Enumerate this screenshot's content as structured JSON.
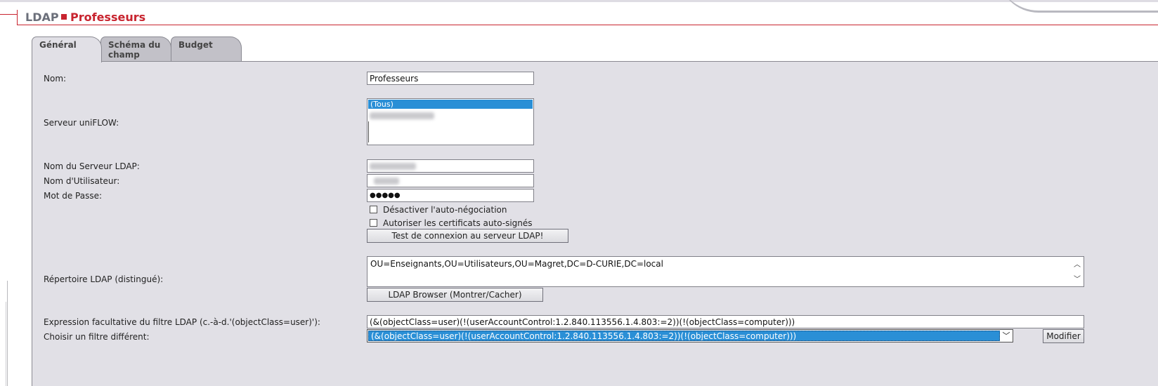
{
  "header": {
    "section": "LDAP",
    "title": "Professeurs"
  },
  "tabs": [
    {
      "label": "Général",
      "active": true
    },
    {
      "label": "Schéma du champ",
      "active": false
    },
    {
      "label": "Budget",
      "active": false
    }
  ],
  "form": {
    "nom_label": "Nom:",
    "nom_value": "Professeurs",
    "serveur_uniflow_label": "Serveur uniFLOW:",
    "serveur_uniflow_options": [
      "(Tous)"
    ],
    "serveur_uniflow_selected": "(Tous)",
    "serveur_ldap_label": "Nom du Serveur LDAP:",
    "utilisateur_label": "Nom d'Utilisateur:",
    "mot_de_passe_label": "Mot de Passe:",
    "mot_de_passe_value": "●●●●●",
    "desactiver_auto_label": "Désactiver l'auto-négociation",
    "autoriser_certs_label": "Autoriser les certificats auto-signés",
    "test_connexion_button": "Test de connexion au serveur LDAP!",
    "repertoire_label": "Répertoire LDAP (distingué):",
    "repertoire_value": "OU=Enseignants,OU=Utilisateurs,OU=Magret,DC=D-CURIE,DC=local",
    "ldap_browser_button": "LDAP Browser (Montrer/Cacher)",
    "filtre_label": "Expression facultative du filtre LDAP (c.-à-d.'(objectClass=user)'):",
    "filtre_value": "(&(objectClass=user)(!(userAccountControl:1.2.840.113556.1.4.803:=2))(!(objectClass=computer)))",
    "choisir_filtre_label": "Choisir un filtre différent:",
    "choisir_filtre_selected": "(&(objectClass=user)(!(userAccountControl:1.2.840.113556.1.4.803:=2))(!(objectClass=computer)))",
    "modifier_button": "Modifier"
  },
  "colors": {
    "accent": "#c8242f",
    "panel": "#e1e0e6",
    "selection": "#2a8fd6"
  }
}
